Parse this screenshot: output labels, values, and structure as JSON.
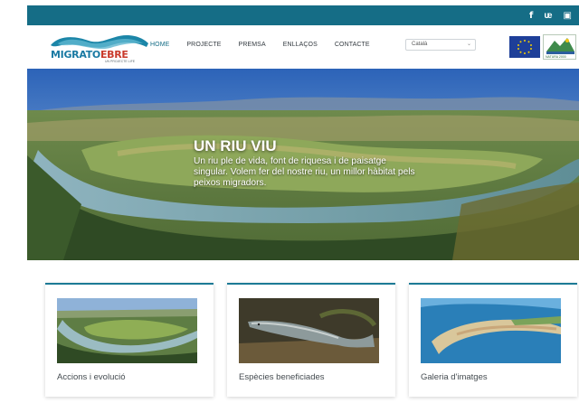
{
  "social": {
    "facebook": "f",
    "twitter": "  y",
    "instagram": "▣"
  },
  "logo": {
    "name_part1": "MIGRATO",
    "name_part2": "EBRE",
    "subtitle": "UN PROJECTE LIFE"
  },
  "nav": {
    "items": [
      "HOME",
      "PROJECTE",
      "PREMSA",
      "ENLLAÇOS",
      "CONTACTE"
    ],
    "active_index": 0
  },
  "language": {
    "selected": "Català",
    "chevron": "⌄"
  },
  "partners": {
    "natura2000": "NATURA 2000"
  },
  "hero": {
    "title": "UN RIU VIU",
    "text": "Un riu ple de vida, font de riquesa i de paisatge singular. Volem fer del nostre riu, un millor hàbitat pels peixos migradors."
  },
  "cards": [
    {
      "caption": "Accions i evolució"
    },
    {
      "caption": "Espècies beneficiades"
    },
    {
      "caption": "Galeria d'imatges"
    }
  ],
  "colors": {
    "brand": "#156d86",
    "accent_red": "#c93a2b"
  }
}
